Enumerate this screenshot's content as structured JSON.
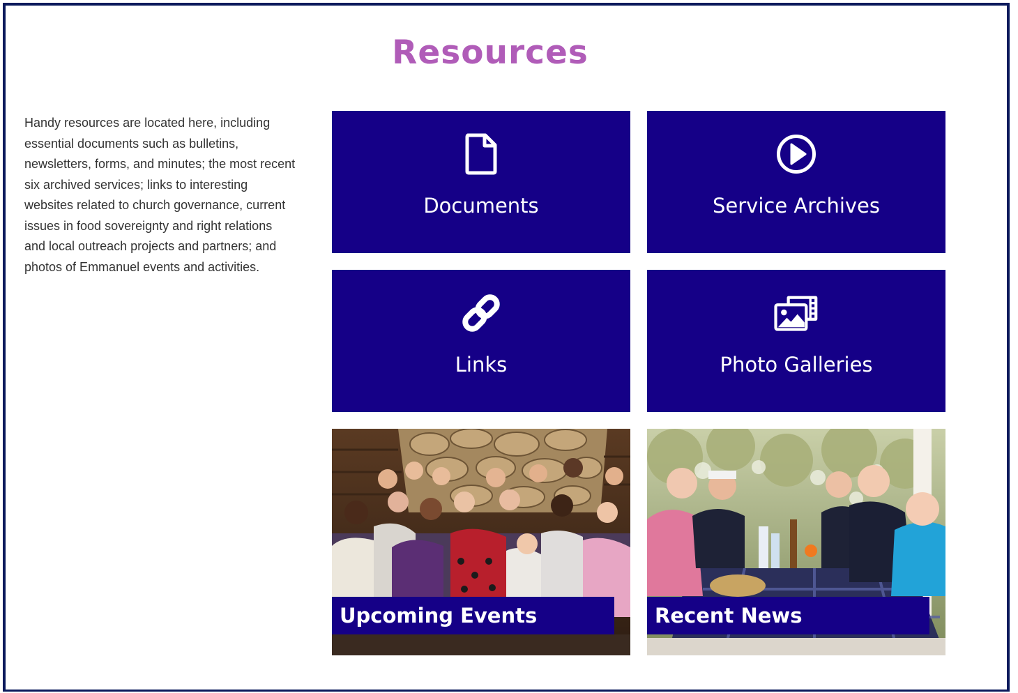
{
  "page": {
    "title": "Resources",
    "intro": "Handy resources are located here, including essential documents such as bulletins, newsletters, forms, and minutes; the most recent six archived services; links to interesting websites related to church governance, current issues in food sovereignty and right relations and local outreach projects and partners; and photos of Emmanuel events and activities."
  },
  "colors": {
    "title": "#b05cb8",
    "tile_background": "#150087",
    "frame_border": "#0a1a5c",
    "body_text": "#333333"
  },
  "tiles": [
    {
      "label": "Documents",
      "icon": "document-icon"
    },
    {
      "label": "Service Archives",
      "icon": "play-circle-icon"
    },
    {
      "label": "Links",
      "icon": "link-icon"
    },
    {
      "label": "Photo Galleries",
      "icon": "photo-gallery-icon"
    }
  ],
  "photo_tiles": [
    {
      "label": "Upcoming Events",
      "image": "group-photo-image"
    },
    {
      "label": "Recent News",
      "image": "picnic-photo-image"
    }
  ]
}
